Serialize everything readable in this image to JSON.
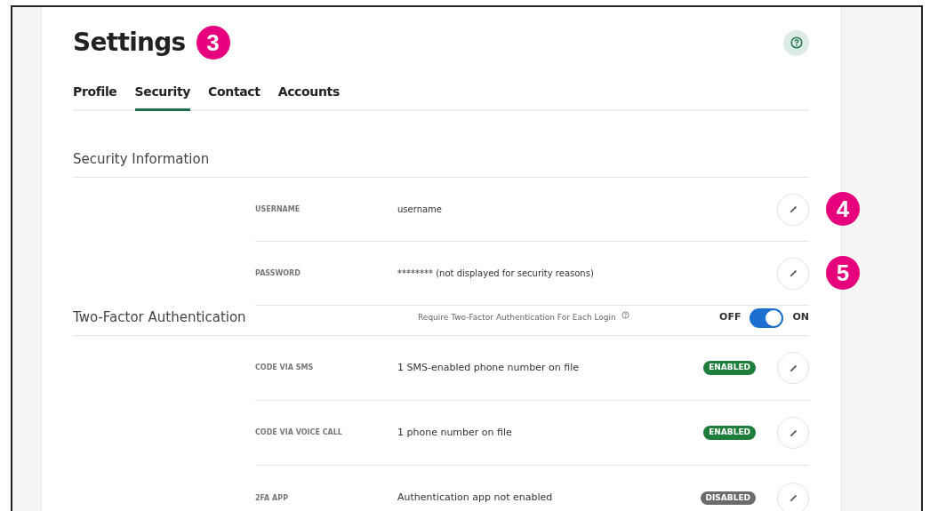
{
  "title": "Settings",
  "title_callout": "3",
  "tabs": [
    {
      "label": "Profile",
      "selected": false
    },
    {
      "label": "Security",
      "selected": true
    },
    {
      "label": "Contact",
      "selected": false
    },
    {
      "label": "Accounts",
      "selected": false
    }
  ],
  "security_information": {
    "heading": "Security Information",
    "rows": [
      {
        "label": "USERNAME",
        "value": "username",
        "callout": "4"
      },
      {
        "label": "PASSWORD",
        "value": "******** (not displayed for security reasons)",
        "callout": "5"
      }
    ]
  },
  "two_factor": {
    "heading": "Two-Factor Authentication",
    "require_label": "Require Two-Factor Authentication For Each Login",
    "toggle": {
      "off_label": "OFF",
      "on_label": "ON",
      "on": true
    },
    "rows": [
      {
        "label": "CODE VIA SMS",
        "value": "1 SMS-enabled phone number on file",
        "status": "ENABLED",
        "enabled": true
      },
      {
        "label": "CODE VIA VOICE CALL",
        "value": "1 phone number on file",
        "status": "ENABLED",
        "enabled": true
      },
      {
        "label": "2FA APP",
        "value": "Authentication app not enabled",
        "status": "DISABLED",
        "enabled": false
      }
    ]
  }
}
